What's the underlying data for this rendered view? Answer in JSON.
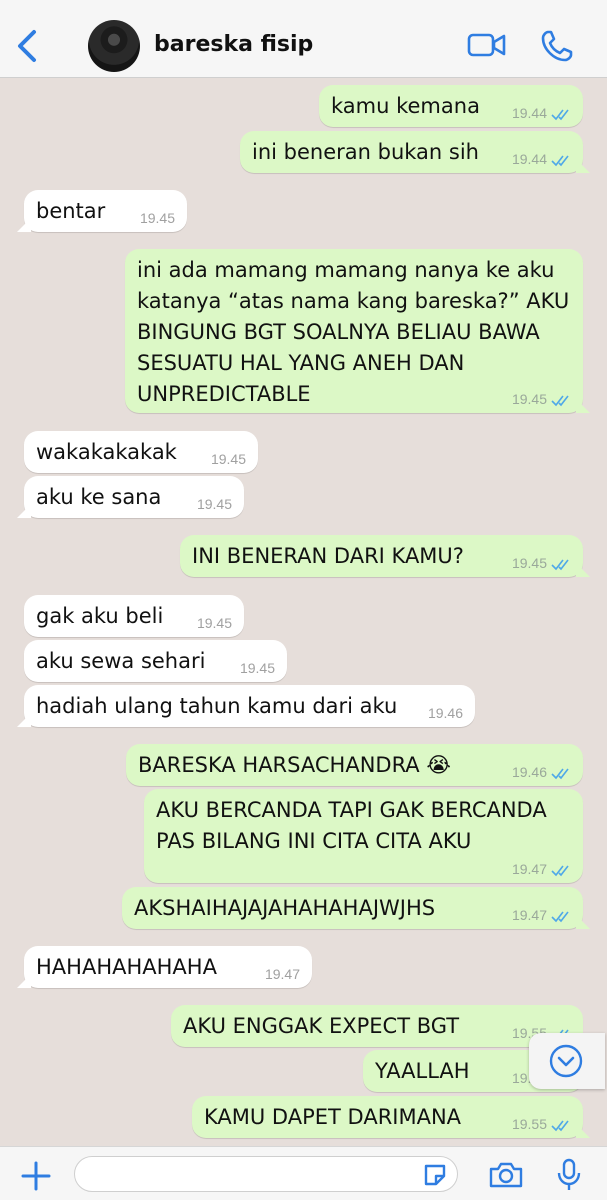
{
  "header": {
    "contact_name": "bareska fisip",
    "back_icon": "chevron-left-icon",
    "video_icon": "video-camera-icon",
    "call_icon": "phone-icon",
    "accent_color": "#2f7de1"
  },
  "messages": [
    {
      "dir": "out",
      "text": "kamu kemana",
      "time": "19.44",
      "status": "read"
    },
    {
      "dir": "out",
      "text": "ini beneran bukan sih",
      "time": "19.44",
      "status": "read"
    },
    {
      "dir": "in",
      "text": "bentar",
      "time": "19.45"
    },
    {
      "dir": "out",
      "text": "ini ada mamang mamang nanya ke aku katanya “atas nama kang bareska?” AKU BINGUNG BGT SOALNYA BELIAU BAWA SESUATU HAL YANG ANEH DAN UNPREDICTABLE",
      "time": "19.45",
      "status": "read"
    },
    {
      "dir": "in",
      "text": "wakakakakak",
      "time": "19.45"
    },
    {
      "dir": "in",
      "text": "aku ke sana",
      "time": "19.45"
    },
    {
      "dir": "out",
      "text": "INI BENERAN DARI KAMU?",
      "time": "19.45",
      "status": "read"
    },
    {
      "dir": "in",
      "text": "gak aku beli",
      "time": "19.45"
    },
    {
      "dir": "in",
      "text": "aku sewa sehari",
      "time": "19.45"
    },
    {
      "dir": "in",
      "text": "hadiah ulang tahun kamu dari aku",
      "time": "19.46"
    },
    {
      "dir": "out",
      "text": "BARESKA HARSACHANDRA 😭",
      "time": "19.46",
      "status": "read"
    },
    {
      "dir": "out",
      "text": "AKU BERCANDA TAPI GAK BERCANDA PAS BILANG INI CITA CITA AKU",
      "time": "19.47",
      "status": "read"
    },
    {
      "dir": "out",
      "text": "AKSHAIHAJAJAHAHAHAJWJHS",
      "time": "19.47",
      "status": "read"
    },
    {
      "dir": "in",
      "text": "HAHAHAHAHAHA",
      "time": "19.47"
    },
    {
      "dir": "out",
      "text": "AKU ENGGAK EXPECT BGT",
      "time": "19.55",
      "status": "read"
    },
    {
      "dir": "out",
      "text": "YAALLAH",
      "time": "19.55",
      "status": "read"
    },
    {
      "dir": "out",
      "text": "KAMU DAPET DARIMANA",
      "time": "19.55",
      "status": "read"
    }
  ],
  "scroll_button_icon": "chevron-down-circle-icon",
  "footer": {
    "input_placeholder": "",
    "attach_icon": "plus-icon",
    "sticker_icon": "sticker-icon",
    "camera_icon": "camera-icon",
    "mic_icon": "microphone-icon"
  }
}
